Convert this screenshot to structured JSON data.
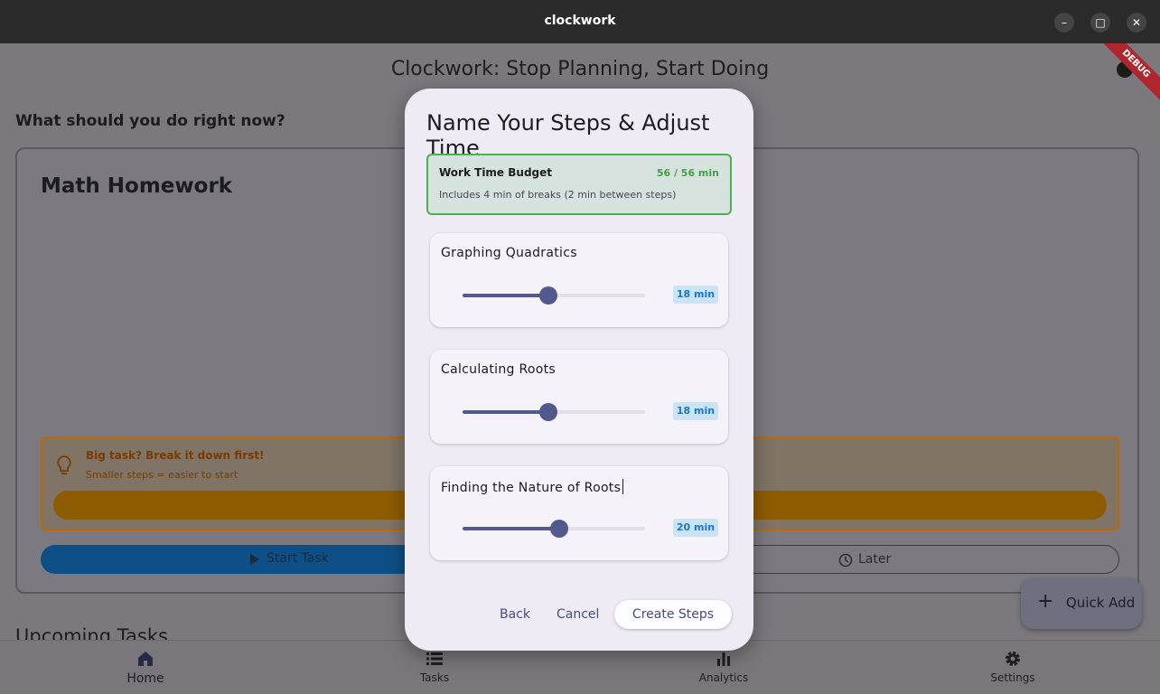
{
  "window": {
    "title": "clockwork",
    "minimize": "–",
    "maximize": "□",
    "close": "✕"
  },
  "app": {
    "title": "Clockwork: Stop Planning, Start Doing",
    "debug_banner": "DEBUG",
    "question": "What should you do right now?",
    "task": {
      "title": "Math Homework",
      "tip_title": "Big task? Break it down first!",
      "tip_subtitle": "Smaller steps = easier to start",
      "start_label": "Start Task",
      "later_label": "Later"
    },
    "upcoming_title": "Upcoming Tasks",
    "quick_add_label": "Quick Add",
    "nav": [
      {
        "label": "Home",
        "icon": "home-icon"
      },
      {
        "label": "Tasks",
        "icon": "list-icon"
      },
      {
        "label": "Analytics",
        "icon": "bar-chart-icon"
      },
      {
        "label": "Settings",
        "icon": "gear-icon"
      }
    ]
  },
  "dialog": {
    "title": "Name Your Steps & Adjust Time",
    "budget": {
      "label": "Work Time Budget",
      "value": "56 / 56 min",
      "note": "Includes 4 min of breaks (2 min between steps)"
    },
    "steps": [
      {
        "name": "Graphing Quadratics",
        "minutes": 18,
        "label": "18 min",
        "fraction": 0.47
      },
      {
        "name": "Calculating Roots",
        "minutes": 18,
        "label": "18 min",
        "fraction": 0.47
      },
      {
        "name": "Finding the Nature of Roots",
        "minutes": 20,
        "label": "20 min",
        "fraction": 0.53
      }
    ],
    "actions": {
      "back": "Back",
      "cancel": "Cancel",
      "create": "Create Steps"
    }
  },
  "colors": {
    "accent": "#52598f",
    "budget_ok": "#4caf50",
    "chip_text": "#1976d2"
  }
}
